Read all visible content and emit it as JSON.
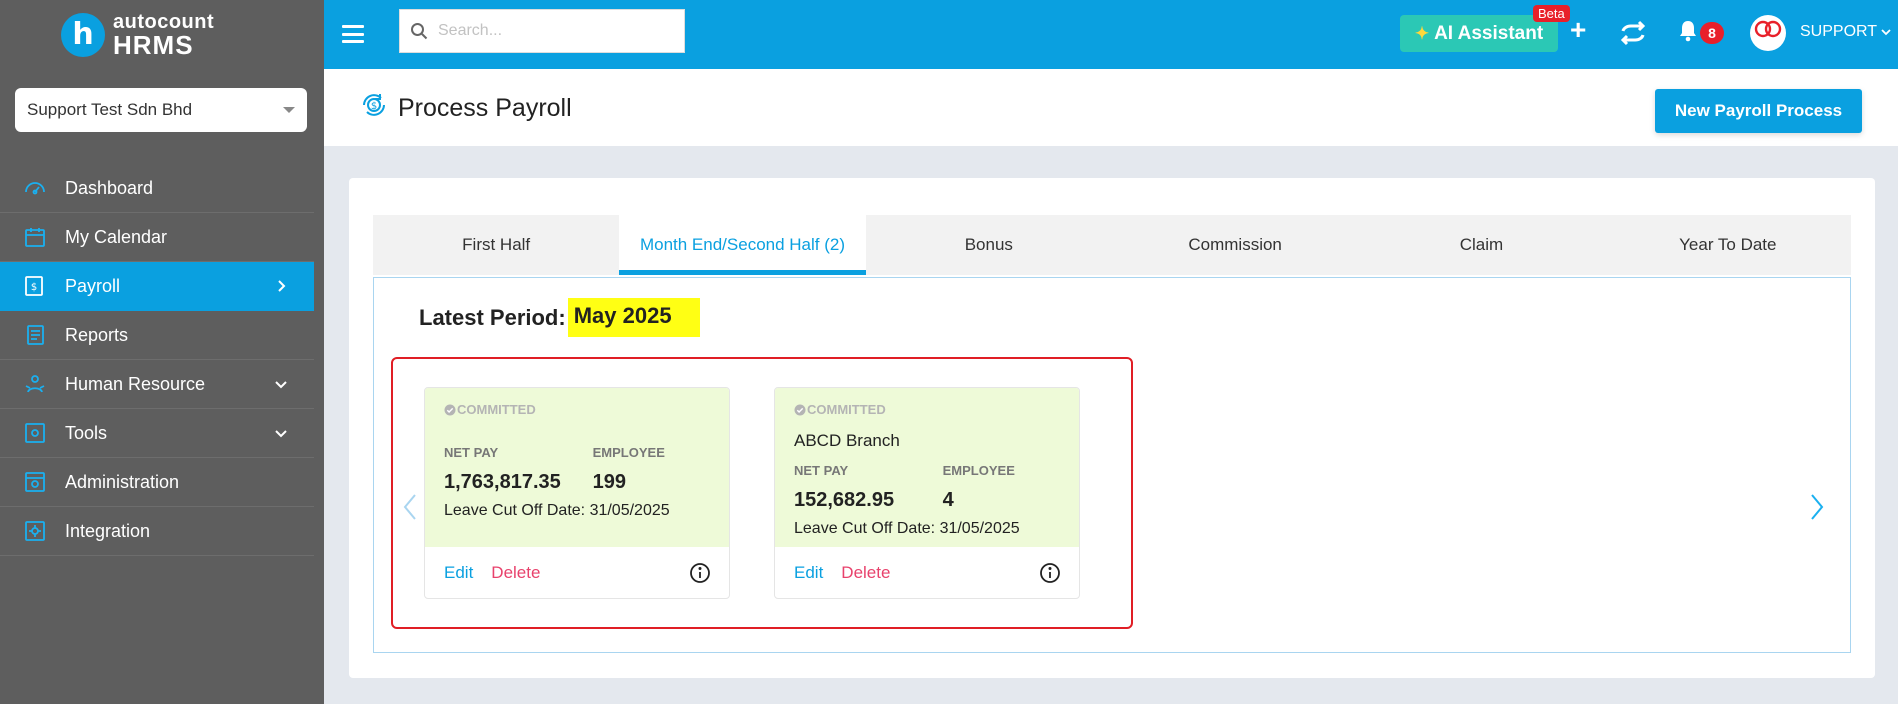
{
  "sidebar": {
    "logo": {
      "brand": "autocount",
      "product": "HRMS",
      "letter": "h"
    },
    "company": "Support Test Sdn Bhd",
    "items": [
      {
        "label": "Dashboard",
        "icon": "dashboard-icon"
      },
      {
        "label": "My Calendar",
        "icon": "calendar-icon"
      },
      {
        "label": "Payroll",
        "icon": "payroll-icon"
      },
      {
        "label": "Reports",
        "icon": "reports-icon"
      },
      {
        "label": "Human Resource",
        "icon": "human-resource-icon"
      },
      {
        "label": "Tools",
        "icon": "tools-icon"
      },
      {
        "label": "Administration",
        "icon": "administration-icon"
      },
      {
        "label": "Integration",
        "icon": "integration-icon"
      }
    ]
  },
  "topbar": {
    "search_placeholder": "Search...",
    "ai_assistant": "AI Assistant",
    "beta": "Beta",
    "notification_count": "8",
    "user": "SUPPORT"
  },
  "header": {
    "title": "Process Payroll",
    "new_button": "New Payroll Process"
  },
  "tabs": [
    {
      "label": "First Half"
    },
    {
      "label": "Month End/Second Half (2)",
      "active": true
    },
    {
      "label": "Bonus"
    },
    {
      "label": "Commission"
    },
    {
      "label": "Claim"
    },
    {
      "label": "Year To Date"
    }
  ],
  "panel": {
    "latest_label": "Latest Period:",
    "latest_value": "May 2025",
    "cards": [
      {
        "status": "COMMITTED",
        "branch": "",
        "net_pay_label": "NET PAY",
        "net_pay": "1,763,817.35",
        "employee_label": "EMPLOYEE",
        "employee": "199",
        "cutoff": "Leave Cut Off Date: 31/05/2025",
        "edit": "Edit",
        "delete": "Delete"
      },
      {
        "status": "COMMITTED",
        "branch": "ABCD Branch",
        "net_pay_label": "NET PAY",
        "net_pay": "152,682.95",
        "employee_label": "EMPLOYEE",
        "employee": "4",
        "cutoff": "Leave Cut Off Date: 31/05/2025",
        "edit": "Edit",
        "delete": "Delete"
      }
    ]
  },
  "colors": {
    "primary": "#0aa0e0",
    "sidebar": "#5e5e5e",
    "highlight": "#ffff14",
    "committed_card": "#eefad8",
    "delete": "#e8426c",
    "outline": "#e01e25"
  }
}
